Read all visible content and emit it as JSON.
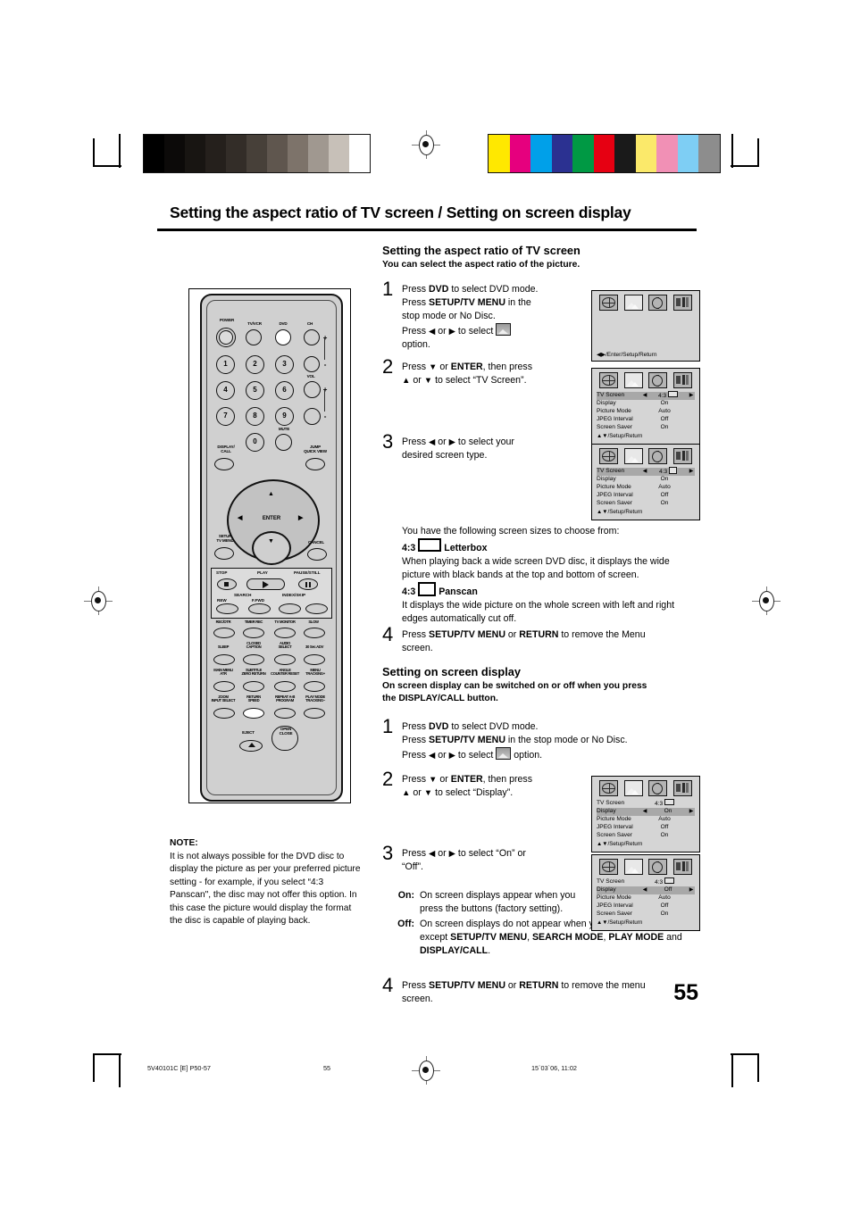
{
  "page": {
    "title": "Setting the aspect ratio of TV screen / Setting on screen display",
    "number": "55"
  },
  "footer": {
    "left": "5V40101C [E] P50-57",
    "center": "55",
    "right": "15`03`06, 11:02"
  },
  "section1": {
    "heading": "Setting the aspect ratio of TV screen",
    "subheading": "You can select the aspect ratio of the picture.",
    "steps": [
      {
        "num": "1",
        "lines": [
          "Press DVD to select DVD mode.",
          "Press SETUP/TV MENU in the stop mode or No Disc.",
          "Press ◀ or ▶ to select [picture] option."
        ]
      },
      {
        "num": "2",
        "lines": [
          "Press ▼ or ENTER, then press ▲ or ▼ to select \"TV Screen\"."
        ]
      },
      {
        "num": "3",
        "lines": [
          "Press ◀ or ▶ to select your desired screen type."
        ]
      },
      {
        "num": "4",
        "lines": [
          "Press SETUP/TV MENU or RETURN to remove the Menu screen."
        ]
      }
    ],
    "choices_intro": "You have the following screen sizes to choose from:",
    "choice1_label": "4:3",
    "choice1_name": "Letterbox",
    "choice1_body": "When playing back a wide screen DVD disc, it displays the wide picture with black bands at the top and bottom of screen.",
    "choice2_label": "4:3",
    "choice2_name": "Panscan",
    "choice2_body": "It displays the wide picture on the whole screen with left and right edges automatically cut off."
  },
  "section2": {
    "heading": "Setting on screen display",
    "subheading": "On screen display can be switched on or off when you press the DISPLAY/CALL button.",
    "steps": [
      {
        "num": "1",
        "lines": [
          "Press DVD to select DVD mode.",
          "Press SETUP/TV MENU in the stop mode or No Disc.",
          "Press ◀ or ▶ to select [picture] option."
        ]
      },
      {
        "num": "2",
        "lines": [
          "Press ▼ or ENTER, then press ▲ or ▼ to select \"Display\"."
        ]
      },
      {
        "num": "3",
        "lines": [
          "Press ◀ or ▶ to select \"On\" or \"Off\"."
        ]
      },
      {
        "num": "4",
        "lines": [
          "Press SETUP/TV MENU or RETURN to remove the menu screen."
        ]
      }
    ],
    "on_label": "On:",
    "on_body": "On screen displays appear when you press the buttons (factory setting).",
    "off_label": "Off:",
    "off_body": "On screen displays do not appear when you press any buttons except SETUP/TV MENU, SEARCH MODE, PLAY MODE and DISPLAY/CALL."
  },
  "note": {
    "label": "NOTE:",
    "body": "It is not always possible for the DVD disc to display the picture as per your preferred picture setting - for example, if you select “4:3 Panscan\", the disc may not offer this option. In this case the picture would display the format the disc is capable of playing back."
  },
  "osd": {
    "icon_names": [
      "language-globe-icon",
      "picture-icon",
      "audio-icon",
      "settings-icon"
    ],
    "rows": {
      "tv_screen": "TV Screen",
      "display": "Display",
      "picture_mode": "Picture Mode",
      "jpeg_interval": "JPEG Interval",
      "screen_saver": "Screen Saver"
    },
    "values": {
      "tv_screen_43": "4:3",
      "display_on": "On",
      "display_off": "Off",
      "picture_mode": "Auto",
      "jpeg_interval": "Off",
      "screen_saver": "On"
    },
    "foot_enter": "◀▶/Enter/Setup/Return",
    "foot_setup": "▲▼/Setup/Return"
  },
  "remote": {
    "labels": {
      "power": "POWER",
      "tvvcr": "TV/VCR",
      "dvd": "DVD",
      "ch": "CH",
      "vol": "VOL",
      "mute": "MUTE",
      "display_call": "DISPLAY/\nCALL",
      "jump_quickview": "JUMP\nQUICK VIEW",
      "setup_tvmenu": "SETUP\nTV MENU",
      "cancel": "CANCEL",
      "enter": "ENTER",
      "stop": "STOP",
      "play": "PLAY",
      "pause_still": "PAUSE/STILL",
      "search": "SEARCH",
      "rew": "REW",
      "ffwd": "F.FWD",
      "index_skip": "INDEX/SKIP",
      "rec_otr": "REC/OTR",
      "timer_rec": "TIMER REC",
      "tv_monitor": "TV MONITOR",
      "slow": "SLOW",
      "sleep": "SLEEP",
      "closed_caption": "CLOSED\nCAPTION",
      "audio_select": "AUDIO\nSELECT",
      "sec_adv": "30 Sec ADV",
      "main_menu_atr": "MAIN MENU\nATR",
      "subtitle_zero": "SUBTITLE\nZERO RETURN",
      "angle_counter": "ANGLE\nCOUNTER RESET",
      "menu_tracking_plus": "MENU\nTRACKING",
      "zoom_input": "ZOOM\nINPUT SELECT",
      "return_speed": "RETURN\nSPEED",
      "repeat_program": "REPEAT A-B\nPROGRAM",
      "playmode_tracking_minus": "PLAY MODE\nTRACKING",
      "eject": "EJECT",
      "open_close": "OPEN\nCLOSE",
      "digits": [
        "1",
        "2",
        "3",
        "4",
        "5",
        "6",
        "7",
        "8",
        "9",
        "0"
      ],
      "plus": "+",
      "minus": "-"
    }
  },
  "colors": {
    "grayscale": [
      "#000000",
      "#0c0a09",
      "#181512",
      "#25201c",
      "#332d28",
      "#474039",
      "#5f564e",
      "#7d736a",
      "#a09890",
      "#c7c0b8",
      "#ffffff"
    ],
    "colorbars": [
      "#ffe800",
      "#e6007e",
      "#00a0e9",
      "#2b3191",
      "#009944",
      "#e60012",
      "#1a1a1a",
      "#fbe96a",
      "#f190b5",
      "#7ecef4",
      "#8d8d8d"
    ]
  }
}
